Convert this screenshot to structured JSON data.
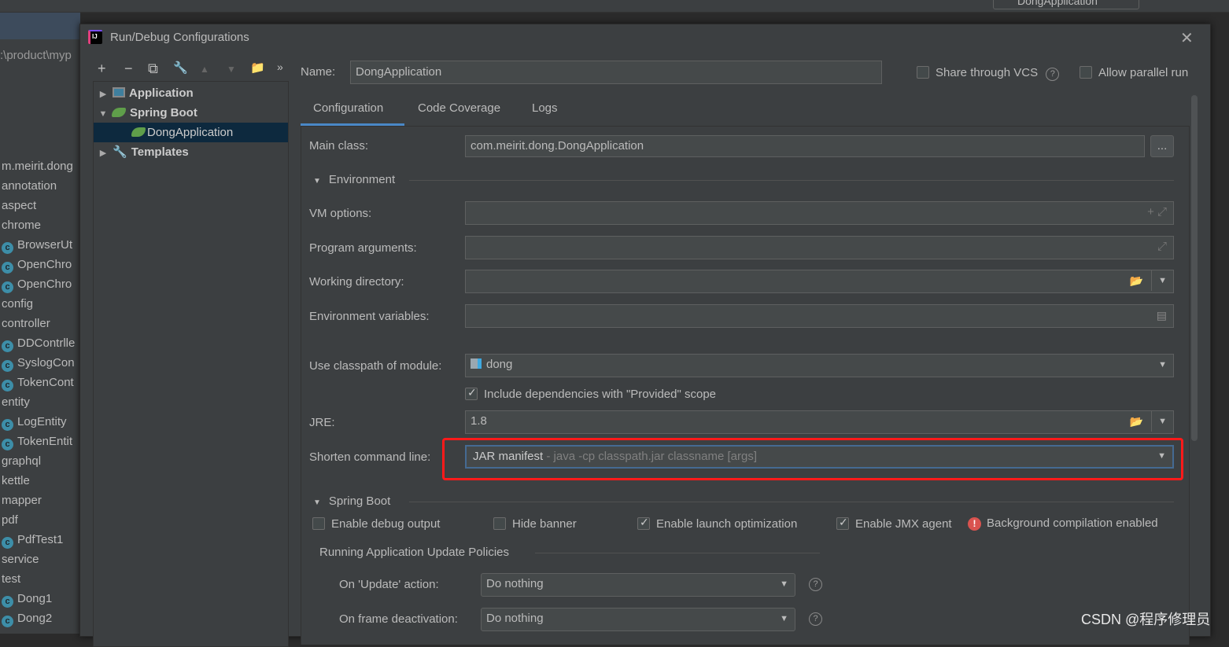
{
  "ide": {
    "run_config_name": "DongApplication",
    "path_fragment": ":\\product\\myp",
    "project_items": [
      {
        "label": "m.meirit.dong",
        "class": false
      },
      {
        "label": "annotation",
        "class": false
      },
      {
        "label": "aspect",
        "class": false
      },
      {
        "label": "chrome",
        "class": false
      },
      {
        "label": "BrowserUt",
        "class": true
      },
      {
        "label": "OpenChro",
        "class": true
      },
      {
        "label": "OpenChro",
        "class": true
      },
      {
        "label": "config",
        "class": false
      },
      {
        "label": "controller",
        "class": false
      },
      {
        "label": "DDContrlle",
        "class": true
      },
      {
        "label": "SyslogCon",
        "class": true
      },
      {
        "label": "TokenCont",
        "class": true
      },
      {
        "label": "entity",
        "class": false
      },
      {
        "label": "LogEntity",
        "class": true
      },
      {
        "label": "TokenEntit",
        "class": true
      },
      {
        "label": "graphql",
        "class": false
      },
      {
        "label": "kettle",
        "class": false
      },
      {
        "label": "mapper",
        "class": false
      },
      {
        "label": "pdf",
        "class": false
      },
      {
        "label": "PdfTest1",
        "class": true
      },
      {
        "label": "service",
        "class": false
      },
      {
        "label": "test",
        "class": false
      },
      {
        "label": "Dong1",
        "class": true
      },
      {
        "label": "Dong2",
        "class": true
      }
    ]
  },
  "dialog": {
    "title": "Run/Debug Configurations",
    "app_icon_text": "IJ",
    "close": "✕",
    "toolbar": {
      "add": "+",
      "remove": "−",
      "copy": "⧉",
      "edit": "🔧",
      "up": "▲",
      "down": "▼",
      "folder": "📁",
      "more": "»"
    },
    "tree": [
      {
        "label": "Application",
        "arrow": "▶"
      },
      {
        "label": "Spring Boot",
        "arrow": "▼"
      },
      {
        "label": "DongApplication",
        "arrow": ""
      },
      {
        "label": "Templates",
        "arrow": "▶"
      }
    ],
    "name_label": "Name:",
    "name_value": "DongApplication",
    "share_vcs": {
      "label": "Share through VCS",
      "checked": false
    },
    "allow_parallel": {
      "label": "Allow parallel run",
      "checked": false
    },
    "help": "?",
    "tabs": [
      "Configuration",
      "Code Coverage",
      "Logs"
    ],
    "active_tab": "Configuration",
    "main_class_label": "Main class:",
    "main_class_value": "com.meirit.dong.DongApplication",
    "browse": "...",
    "environment_header": "Environment",
    "vm_options_label": "VM options:",
    "program_args_label": "Program arguments:",
    "working_dir_label": "Working directory:",
    "env_vars_label": "Environment variables:",
    "classpath_label": "Use classpath of module:",
    "classpath_value": "dong",
    "include_provided": {
      "label": "Include dependencies with \"Provided\" scope",
      "checked": true
    },
    "jre_label": "JRE:",
    "jre_value": "1.8",
    "shorten_label": "Shorten command line:",
    "shorten_value": "JAR manifest",
    "shorten_hint": "- java -cp classpath.jar classname [args]",
    "spring_boot_header": "Spring Boot",
    "enable_debug": {
      "label": "Enable debug output",
      "checked": false
    },
    "hide_banner": {
      "label": "Hide banner",
      "checked": false
    },
    "launch_opt": {
      "label": "Enable launch optimization",
      "checked": true
    },
    "jmx": {
      "label": "Enable JMX agent",
      "checked": true
    },
    "bg_compile": "Background compilation enabled",
    "policies_header": "Running Application Update Policies",
    "on_update_label": "On 'Update' action:",
    "on_update_value": "Do nothing",
    "on_frame_label": "On frame deactivation:",
    "on_frame_value": "Do nothing"
  },
  "highlight_color": "#ff1a1a",
  "accent_color": "#4a88c7",
  "watermark": "CSDN @程序修理员"
}
